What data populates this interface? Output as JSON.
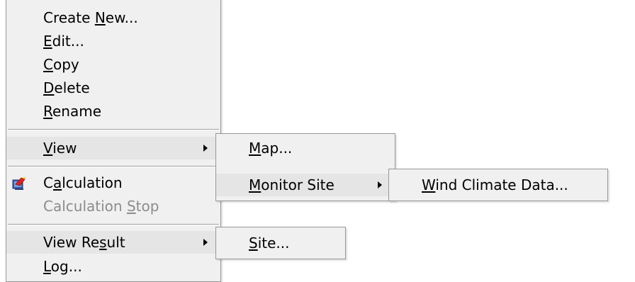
{
  "main_menu": {
    "items": [
      {
        "id": "create_new",
        "before": "Create ",
        "ul": "N",
        "after": "ew..."
      },
      {
        "id": "edit",
        "before": "",
        "ul": "E",
        "after": "dit..."
      },
      {
        "id": "copy",
        "before": "",
        "ul": "C",
        "after": "opy"
      },
      {
        "id": "delete",
        "before": "",
        "ul": "D",
        "after": "elete"
      },
      {
        "id": "rename",
        "before": "",
        "ul": "R",
        "after": "ename"
      },
      {
        "id": "view",
        "before": "",
        "ul": "V",
        "after": "iew"
      },
      {
        "id": "calculation",
        "before": "C",
        "ul": "a",
        "after": "lculation",
        "icon": "calculation-icon"
      },
      {
        "id": "calculation_stop",
        "before": "Calculation ",
        "ul": "S",
        "after": "top",
        "disabled": true
      },
      {
        "id": "view_result",
        "before": "View Re",
        "ul": "s",
        "after": "ult"
      },
      {
        "id": "log",
        "before": "",
        "ul": "L",
        "after": "og..."
      }
    ]
  },
  "view_submenu": {
    "items": [
      {
        "id": "map",
        "before": "",
        "ul": "M",
        "after": "ap..."
      },
      {
        "id": "monitor_site",
        "before": "",
        "ul": "M",
        "after": "onitor Site"
      }
    ]
  },
  "monitor_submenu": {
    "items": [
      {
        "id": "wind_climate_data",
        "before": "",
        "ul": "W",
        "after": "ind Climate Data..."
      }
    ]
  },
  "result_submenu": {
    "items": [
      {
        "id": "site",
        "before": "",
        "ul": "S",
        "after": "ite..."
      }
    ]
  },
  "colors": {
    "menu_background": "#f0f0f0",
    "menu_border": "#979797",
    "disabled_text": "#8c8c8c",
    "highlight": "#e5e5e5"
  }
}
